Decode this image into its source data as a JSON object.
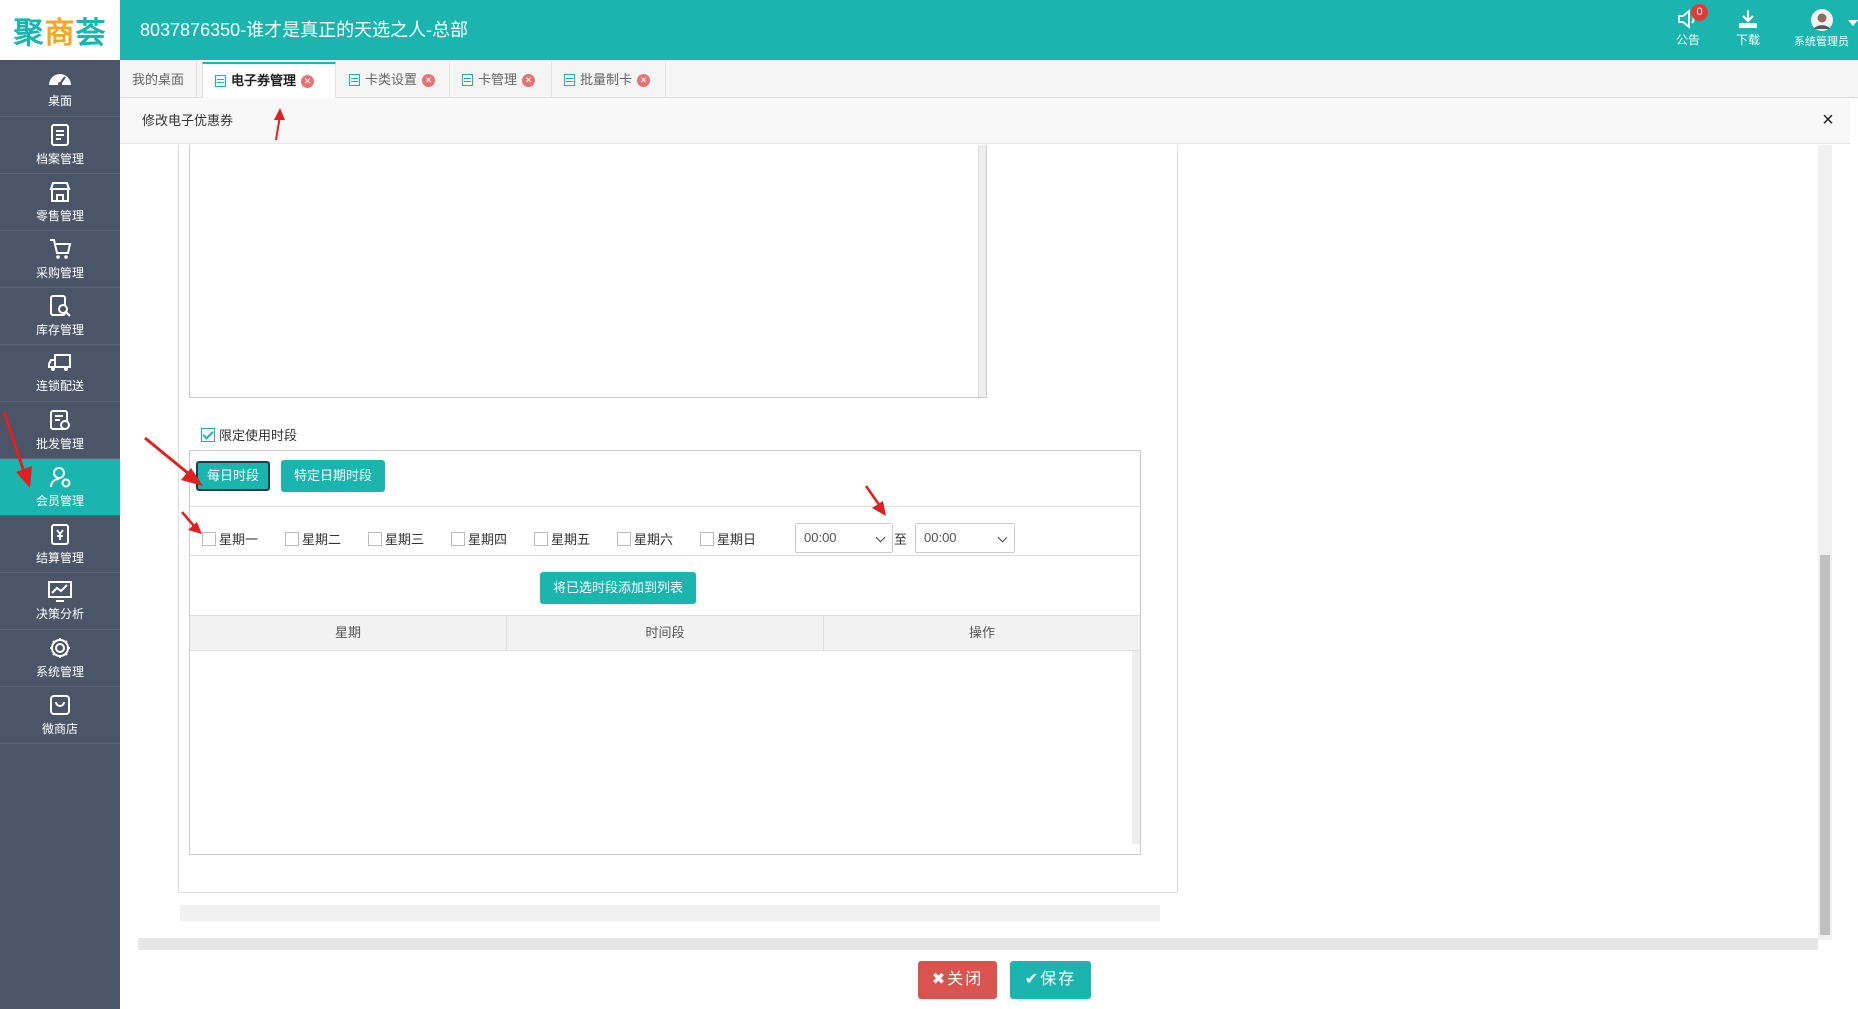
{
  "header": {
    "logo": {
      "left": "聚",
      "mid": "商",
      "right": "荟"
    },
    "title": "8037876350-谁才是真正的天选之人-总部",
    "notice_label": "公告",
    "notice_badge": "0",
    "download_label": "下载",
    "user_label": "系统管理员"
  },
  "sidebar": {
    "items": [
      {
        "label": "桌面",
        "icon": "dashboard-icon"
      },
      {
        "label": "档案管理",
        "icon": "archive-icon"
      },
      {
        "label": "零售管理",
        "icon": "store-icon"
      },
      {
        "label": "采购管理",
        "icon": "cart-icon"
      },
      {
        "label": "库存管理",
        "icon": "inventory-icon"
      },
      {
        "label": "连锁配送",
        "icon": "truck-icon"
      },
      {
        "label": "批发管理",
        "icon": "wholesale-icon"
      },
      {
        "label": "会员管理",
        "icon": "member-icon",
        "active": true
      },
      {
        "label": "结算管理",
        "icon": "settlement-icon"
      },
      {
        "label": "决策分析",
        "icon": "chart-icon"
      },
      {
        "label": "系统管理",
        "icon": "gear-icon"
      },
      {
        "label": "微商店",
        "icon": "bag-icon"
      }
    ]
  },
  "tabs": [
    {
      "label": "我的桌面"
    },
    {
      "label": "电子券管理",
      "active": true
    },
    {
      "label": "卡类设置"
    },
    {
      "label": "卡管理"
    },
    {
      "label": "批量制卡"
    }
  ],
  "dialog": {
    "title": "修改电子优惠券",
    "close_symbol": "×"
  },
  "form": {
    "limit_label": "限定使用时段",
    "limit_checked": true,
    "daily_button": "每日时段",
    "special_button": "特定日期时段",
    "days": [
      "星期一",
      "星期二",
      "星期三",
      "星期四",
      "星期五",
      "星期六",
      "星期日"
    ],
    "time_from": "00:00",
    "to_label": "至",
    "time_to": "00:00",
    "add_button": "将已选时段添加到列表",
    "table_headers": [
      "星期",
      "时间段",
      "操作"
    ]
  },
  "footer": {
    "close_button": "关闭",
    "save_button": "保存"
  },
  "colors": {
    "accent": "#19b5ae",
    "sidebar": "#4a5668",
    "danger": "#d9534f",
    "annotation": "#e02020"
  }
}
